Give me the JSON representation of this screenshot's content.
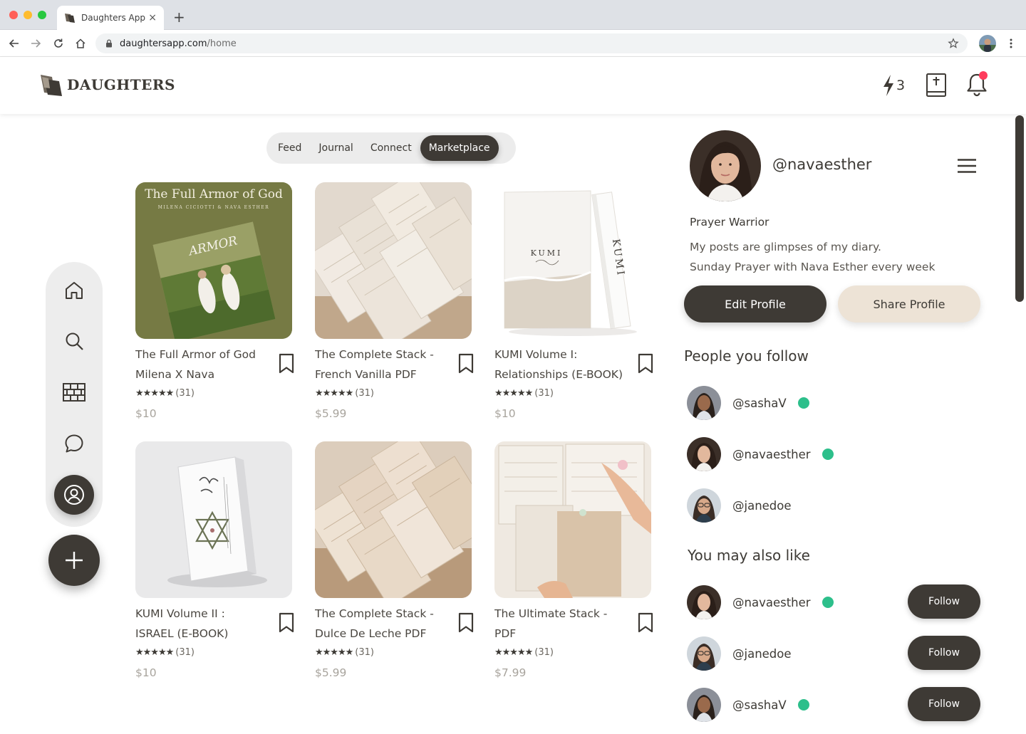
{
  "browser": {
    "tab_title": "Daughters App",
    "tab_close": "×",
    "new_tab": "+",
    "url_host": "daughtersapp.com",
    "url_path": "/home"
  },
  "header": {
    "brand": "DAUGHTERS",
    "streak_count": "3",
    "has_notification": true
  },
  "rail": {
    "items": [
      "home",
      "search",
      "marketplace",
      "messages",
      "profile"
    ],
    "active": "profile"
  },
  "tabs": {
    "items": [
      "Feed",
      "Journal",
      "Connect",
      "Marketplace"
    ],
    "active": "Marketplace"
  },
  "products": [
    {
      "title_line1": "The Full Armor of God",
      "title_line2": "Milena X Nava",
      "stars": "★★★★★",
      "rating_count": "(31)",
      "price": "$10",
      "cover_title": "The Full Armor of God",
      "cover_subtitle": "MILENA CICIOTTI & NAVA ESTHER",
      "cover_book": "ARMOR"
    },
    {
      "title_line1": "The Complete Stack -",
      "title_line2": "French Vanilla PDF",
      "stars": "★★★★★",
      "rating_count": "(31)",
      "price": "$5.99"
    },
    {
      "title_line1": "KUMI Volume I:",
      "title_line2": "Relationships (E-BOOK)",
      "stars": "★★★★★",
      "rating_count": "(31)",
      "price": "$10",
      "cover_title": "KUMI",
      "cover_spine": "KUMI"
    },
    {
      "title_line1": "KUMI Volume II :",
      "title_line2": "ISRAEL (E-BOOK)",
      "stars": "★★★★★",
      "rating_count": "(31)",
      "price": "$10"
    },
    {
      "title_line1": "The Complete Stack -",
      "title_line2": "Dulce De Leche PDF",
      "stars": "★★★★★",
      "rating_count": "(31)",
      "price": "$5.99"
    },
    {
      "title_line1": "The Ultimate Stack -",
      "title_line2": "PDF",
      "stars": "★★★★★",
      "rating_count": "(31)",
      "price": "$7.99"
    }
  ],
  "profile": {
    "handle": "@navaesther",
    "role": "Prayer Warrior",
    "bio_line1": "My posts are glimpses of my diary.",
    "bio_line2": "Sunday Prayer with Nava Esther every week",
    "edit_label": "Edit Profile",
    "share_label": "Share Profile"
  },
  "following": {
    "title": "People you follow",
    "people": [
      {
        "handle": "@sashaV",
        "online": true
      },
      {
        "handle": "@navaesther",
        "online": true
      },
      {
        "handle": "@janedoe",
        "online": false
      }
    ]
  },
  "suggestions": {
    "title": "You may also like",
    "follow_label": "Follow",
    "people": [
      {
        "handle": "@navaesther",
        "online": true
      },
      {
        "handle": "@janedoe",
        "online": false
      },
      {
        "handle": "@sashaV",
        "online": true
      }
    ]
  },
  "colors": {
    "primary_dark": "#3e3a35",
    "beige": "#ede3d6",
    "online": "#2dbf8b",
    "notification": "#ff3b5c",
    "price": "#a8a49d"
  }
}
